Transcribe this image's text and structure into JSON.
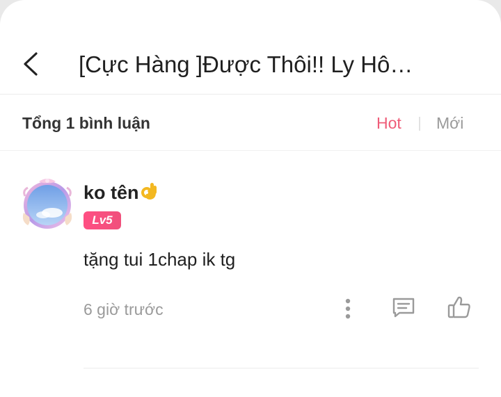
{
  "header": {
    "back_icon": "chevron-left-icon",
    "title": "[Cực Hàng ]Được Thôi!! Ly Hô…"
  },
  "comments_bar": {
    "count_label": "Tổng 1 bình luận",
    "tabs": [
      {
        "label": "Hot",
        "active": true
      },
      {
        "label": "Mới",
        "active": false
      }
    ],
    "active_color": "#ef5c78"
  },
  "comments": [
    {
      "username": "ko tên",
      "username_emoji": "ok-hand-emoji",
      "level": "Lv5",
      "text": "tặng tui 1chap ik tg",
      "time": "6 giờ trước",
      "actions": [
        "more-vertical-icon",
        "comment-reply-icon",
        "thumbs-up-icon"
      ]
    }
  ]
}
